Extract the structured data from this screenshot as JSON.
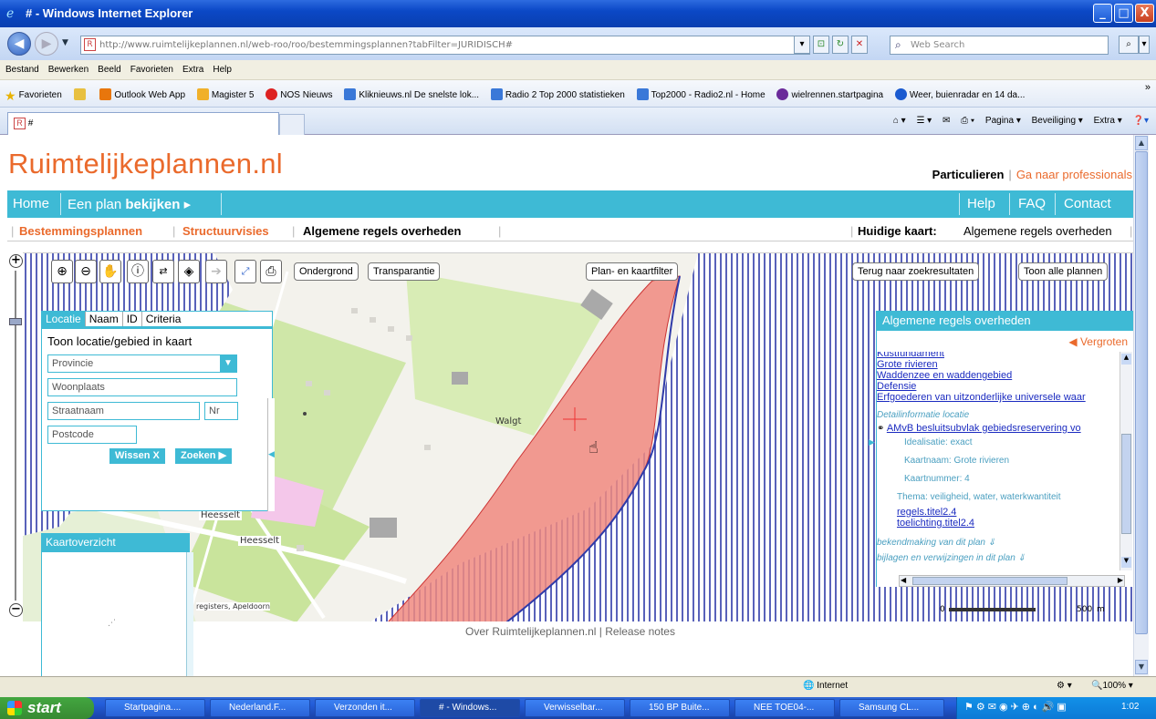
{
  "window": {
    "title": "# - Windows Internet Explorer",
    "btn_min": "_",
    "btn_max": "□",
    "btn_close": "X"
  },
  "address": {
    "url_host": "http://www.ruimtelijkeplannen.nl",
    "url_path": "/web-roo/roo/bestemmingsplannen?tabFilter=JURIDISCH#",
    "search_placeholder": "Web Search"
  },
  "menu": [
    "Bestand",
    "Bewerken",
    "Beeld",
    "Favorieten",
    "Extra",
    "Help"
  ],
  "favorites": {
    "label": "Favorieten",
    "items": [
      "Outlook Web App",
      "Magister 5",
      "NOS Nieuws",
      "Kliknieuws.nl De snelste lok...",
      "Radio 2 Top 2000 statistieken",
      "Top2000 - Radio2.nl - Home",
      "wielrennen.startpagina",
      "Weer, buienradar en 14 da..."
    ]
  },
  "tab": {
    "title": "#"
  },
  "commands": [
    "Pagina ▾",
    "Beveiliging ▾",
    "Extra ▾"
  ],
  "site": {
    "logo": "Ruimtelijkeplannen.nl",
    "particulieren": "Particulieren",
    "separator": "|",
    "professionals": "Ga naar professionals",
    "nav": {
      "home": "Home",
      "plan_prefix": "Een plan",
      "plan_bold": "bekijken",
      "help": "Help",
      "faq": "FAQ",
      "contact": "Contact"
    },
    "subnav": {
      "bestemmingsplannen": "Bestemmingsplannen",
      "structuurvisies": "Structuurvisies",
      "algemene": "Algemene regels overheden",
      "huidige_label": "Huidige kaart:",
      "huidige_value": "Algemene regels overheden"
    }
  },
  "map": {
    "buttons": {
      "ondergrond": "Ondergrond",
      "transparantie": "Transparantie",
      "filter": "Plan- en kaartfilter",
      "terug": "Terug naar zoekresultaten",
      "toon": "Toon alle plannen"
    },
    "labels": {
      "walgt": "Walgt",
      "heesselt1": "Heesselt",
      "heesselt2": "Heesselt",
      "credits": "registers, Apeldoorn"
    },
    "scale": {
      "zero": "0",
      "five": "500",
      "m": "m"
    }
  },
  "location_panel": {
    "tabs": [
      "Locatie",
      "Naam",
      "ID",
      "Criteria"
    ],
    "title": "Toon locatie/gebied in kaart",
    "provincie": "Provincie",
    "woonplaats": "Woonplaats",
    "straatnaam": "Straatnaam",
    "nr": "Nr",
    "postcode": "Postcode",
    "wissen": "Wissen X",
    "zoeken": "Zoeken ▶"
  },
  "overview": {
    "title": "Kaartoverzicht"
  },
  "right_panel": {
    "title": "Algemene regels overheden",
    "vergroten": "Vergroten",
    "links": [
      "Kustfundament",
      "Grote rivieren",
      "Waddenzee en waddengebied",
      "Defensie",
      "Erfgoederen van uitzonderlijke universele waar"
    ],
    "detail_header": "Detailinformatie locatie",
    "detail_link": "AMvB besluitsubvlak gebiedsreservering vo",
    "details": [
      "Idealisatie: exact",
      "Kaartnaam: Grote rivieren",
      "Kaartnummer: 4",
      "Thema: veiligheid, water, waterkwantiteit"
    ],
    "sub_links": [
      "regels.titel2.4",
      "toelichting.titel2.4"
    ],
    "bekendmaking": "bekendmaking van dit plan",
    "bijlagen": "bijlagen en verwijzingen in dit plan"
  },
  "footer": {
    "over": "Over Ruimtelijkeplannen.nl",
    "sep": "|",
    "release": "Release notes"
  },
  "status": {
    "zone": "Internet",
    "zoom": "100%"
  },
  "taskbar": {
    "start": "start",
    "items": [
      "Startpagina....",
      "Nederland.F...",
      "Verzonden it...",
      "# - Windows...",
      "Verwisselbar...",
      "150 BP Buite...",
      "NEE TOE04-...",
      "Samsung CL..."
    ],
    "clock": "1:02"
  },
  "colors": {
    "brand_orange": "#ea6a2c",
    "brand_blue": "#3ebad5",
    "plan_red": "#f08a80",
    "hatch_blue": "#2f3aa8"
  }
}
